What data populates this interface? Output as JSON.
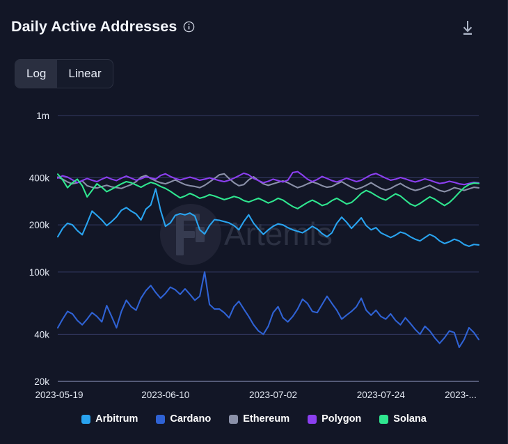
{
  "header": {
    "title": "Daily Active Addresses",
    "info_icon": "info-circle-icon",
    "download_icon": "download-icon"
  },
  "scale_toggle": {
    "options": [
      {
        "label": "Log",
        "active": true
      },
      {
        "label": "Linear",
        "active": false
      }
    ]
  },
  "watermark": {
    "text": "Artemis"
  },
  "colors": {
    "background": "#121626",
    "gridline": "#343a63",
    "axis": "#6a7190",
    "text": "#e3e8f2",
    "toggle_active_bg": "#2a2f40"
  },
  "chart_data": {
    "type": "line",
    "title": "Daily Active Addresses",
    "xlabel": "",
    "ylabel": "",
    "yscale": "log",
    "grid": true,
    "legend_position": "bottom",
    "ylim": [
      20000,
      1000000
    ],
    "ytick_values": [
      1000000,
      400000,
      200000,
      100000,
      40000,
      20000
    ],
    "ytick_labels": [
      "1m",
      "400k",
      "200k",
      "100k",
      "40k",
      "20k"
    ],
    "x": [
      "2023-05-19",
      "2023-05-20",
      "2023-05-21",
      "2023-05-22",
      "2023-05-23",
      "2023-05-24",
      "2023-05-25",
      "2023-05-26",
      "2023-05-27",
      "2023-05-28",
      "2023-05-29",
      "2023-05-30",
      "2023-05-31",
      "2023-06-01",
      "2023-06-02",
      "2023-06-03",
      "2023-06-04",
      "2023-06-05",
      "2023-06-06",
      "2023-06-07",
      "2023-06-08",
      "2023-06-09",
      "2023-06-10",
      "2023-06-11",
      "2023-06-12",
      "2023-06-13",
      "2023-06-14",
      "2023-06-15",
      "2023-06-16",
      "2023-06-17",
      "2023-06-18",
      "2023-06-19",
      "2023-06-20",
      "2023-06-21",
      "2023-06-22",
      "2023-06-23",
      "2023-06-24",
      "2023-06-25",
      "2023-06-26",
      "2023-06-27",
      "2023-06-28",
      "2023-06-29",
      "2023-06-30",
      "2023-07-01",
      "2023-07-02",
      "2023-07-03",
      "2023-07-04",
      "2023-07-05",
      "2023-07-06",
      "2023-07-07",
      "2023-07-08",
      "2023-07-09",
      "2023-07-10",
      "2023-07-11",
      "2023-07-12",
      "2023-07-13",
      "2023-07-14",
      "2023-07-15",
      "2023-07-16",
      "2023-07-17",
      "2023-07-18",
      "2023-07-19",
      "2023-07-20",
      "2023-07-21",
      "2023-07-22",
      "2023-07-23",
      "2023-07-24",
      "2023-07-25",
      "2023-07-26",
      "2023-07-27",
      "2023-07-28",
      "2023-07-29",
      "2023-07-30",
      "2023-07-31",
      "2023-08-01",
      "2023-08-02",
      "2023-08-03",
      "2023-08-04",
      "2023-08-05",
      "2023-08-06",
      "2023-08-07",
      "2023-08-08",
      "2023-08-09",
      "2023-08-10",
      "2023-08-11",
      "2023-08-12",
      "2023-08-13"
    ],
    "xtick_labels": [
      "2023-05-19",
      "2023-06-10",
      "2023-07-02",
      "2023-07-24",
      "2023-..."
    ],
    "xtick_indices": [
      0,
      22,
      44,
      66,
      85
    ],
    "series": [
      {
        "name": "Arbitrum",
        "color": "#29a3ef",
        "values": [
          168000,
          190000,
          205000,
          200000,
          184000,
          173000,
          205000,
          245000,
          230000,
          215000,
          198000,
          210000,
          225000,
          248000,
          258000,
          245000,
          235000,
          215000,
          252000,
          268000,
          340000,
          248000,
          196000,
          206000,
          230000,
          236000,
          232000,
          238000,
          228000,
          186000,
          175000,
          198000,
          216000,
          214000,
          210000,
          206000,
          198000,
          186000,
          210000,
          232000,
          205000,
          188000,
          174000,
          186000,
          196000,
          203000,
          200000,
          192000,
          186000,
          182000,
          178000,
          186000,
          196000,
          188000,
          176000,
          168000,
          178000,
          205000,
          224000,
          208000,
          190000,
          205000,
          222000,
          198000,
          186000,
          192000,
          178000,
          172000,
          166000,
          172000,
          180000,
          176000,
          168000,
          162000,
          158000,
          166000,
          174000,
          168000,
          158000,
          152000,
          156000,
          162000,
          158000,
          150000,
          146000,
          150000,
          149000
        ]
      },
      {
        "name": "Cardano",
        "color": "#2f62d4",
        "values": [
          44000,
          50000,
          56000,
          54000,
          49000,
          46000,
          50000,
          55000,
          52000,
          48000,
          61000,
          52000,
          44000,
          56000,
          66000,
          60000,
          57000,
          68000,
          76000,
          82000,
          74000,
          68000,
          73000,
          80000,
          77000,
          72000,
          78000,
          72000,
          66000,
          70000,
          100000,
          62000,
          58000,
          58000,
          55000,
          51000,
          60000,
          65000,
          58000,
          52000,
          46000,
          42000,
          40000,
          45000,
          55000,
          60000,
          51000,
          48000,
          52000,
          58000,
          67000,
          63000,
          56000,
          55000,
          62000,
          70000,
          63000,
          57000,
          50000,
          53000,
          56000,
          60000,
          68000,
          57000,
          53000,
          57000,
          52000,
          50000,
          54000,
          49000,
          46000,
          51000,
          47000,
          43000,
          40000,
          45000,
          42000,
          38000,
          35000,
          38000,
          42000,
          41000,
          33000,
          37000,
          44000,
          41000,
          37000
        ]
      },
      {
        "name": "Ethereum",
        "color": "#8a90a8",
        "values": [
          404000,
          392000,
          376000,
          366000,
          372000,
          382000,
          356000,
          348000,
          344000,
          352000,
          358000,
          350000,
          346000,
          342000,
          352000,
          362000,
          378000,
          404000,
          414000,
          396000,
          382000,
          372000,
          366000,
          376000,
          388000,
          374000,
          362000,
          356000,
          352000,
          346000,
          358000,
          376000,
          396000,
          418000,
          424000,
          396000,
          372000,
          356000,
          362000,
          388000,
          406000,
          384000,
          366000,
          358000,
          366000,
          374000,
          382000,
          372000,
          358000,
          346000,
          354000,
          366000,
          376000,
          368000,
          356000,
          348000,
          352000,
          366000,
          378000,
          362000,
          348000,
          338000,
          346000,
          358000,
          372000,
          356000,
          342000,
          334000,
          342000,
          356000,
          368000,
          352000,
          340000,
          332000,
          338000,
          348000,
          358000,
          344000,
          332000,
          326000,
          334000,
          346000,
          340000,
          332000,
          340000,
          348000,
          345000
        ]
      },
      {
        "name": "Polygon",
        "color": "#8b3ff0",
        "values": [
          398000,
          412000,
          404000,
          388000,
          372000,
          384000,
          396000,
          386000,
          378000,
          392000,
          404000,
          392000,
          384000,
          398000,
          410000,
          398000,
          386000,
          394000,
          406000,
          400000,
          392000,
          414000,
          424000,
          408000,
          396000,
          388000,
          396000,
          404000,
          396000,
          386000,
          392000,
          400000,
          392000,
          384000,
          378000,
          386000,
          398000,
          412000,
          428000,
          418000,
          396000,
          384000,
          372000,
          380000,
          392000,
          384000,
          376000,
          386000,
          432000,
          438000,
          416000,
          392000,
          378000,
          390000,
          408000,
          396000,
          384000,
          376000,
          386000,
          398000,
          388000,
          378000,
          386000,
          402000,
          418000,
          426000,
          412000,
          398000,
          386000,
          392000,
          402000,
          394000,
          384000,
          376000,
          384000,
          394000,
          386000,
          376000,
          368000,
          372000,
          380000,
          374000,
          366000,
          362000,
          368000,
          374000,
          371000
        ]
      },
      {
        "name": "Solana",
        "color": "#2fe68f",
        "values": [
          422000,
          388000,
          346000,
          372000,
          392000,
          356000,
          302000,
          332000,
          366000,
          348000,
          326000,
          338000,
          352000,
          366000,
          378000,
          372000,
          360000,
          348000,
          362000,
          374000,
          366000,
          352000,
          342000,
          328000,
          312000,
          298000,
          306000,
          318000,
          308000,
          296000,
          302000,
          312000,
          306000,
          298000,
          290000,
          296000,
          304000,
          298000,
          286000,
          280000,
          288000,
          296000,
          286000,
          276000,
          284000,
          296000,
          288000,
          274000,
          262000,
          254000,
          266000,
          278000,
          288000,
          278000,
          266000,
          272000,
          286000,
          296000,
          284000,
          272000,
          278000,
          296000,
          318000,
          332000,
          322000,
          308000,
          296000,
          288000,
          302000,
          316000,
          306000,
          288000,
          272000,
          264000,
          274000,
          288000,
          302000,
          292000,
          278000,
          266000,
          278000,
          298000,
          322000,
          346000,
          362000,
          370000,
          368000
        ]
      }
    ]
  },
  "legend": {
    "items": [
      {
        "label": "Arbitrum",
        "color": "#29a3ef"
      },
      {
        "label": "Cardano",
        "color": "#2f62d4"
      },
      {
        "label": "Ethereum",
        "color": "#8a90a8"
      },
      {
        "label": "Polygon",
        "color": "#8b3ff0"
      },
      {
        "label": "Solana",
        "color": "#2fe68f"
      }
    ]
  }
}
